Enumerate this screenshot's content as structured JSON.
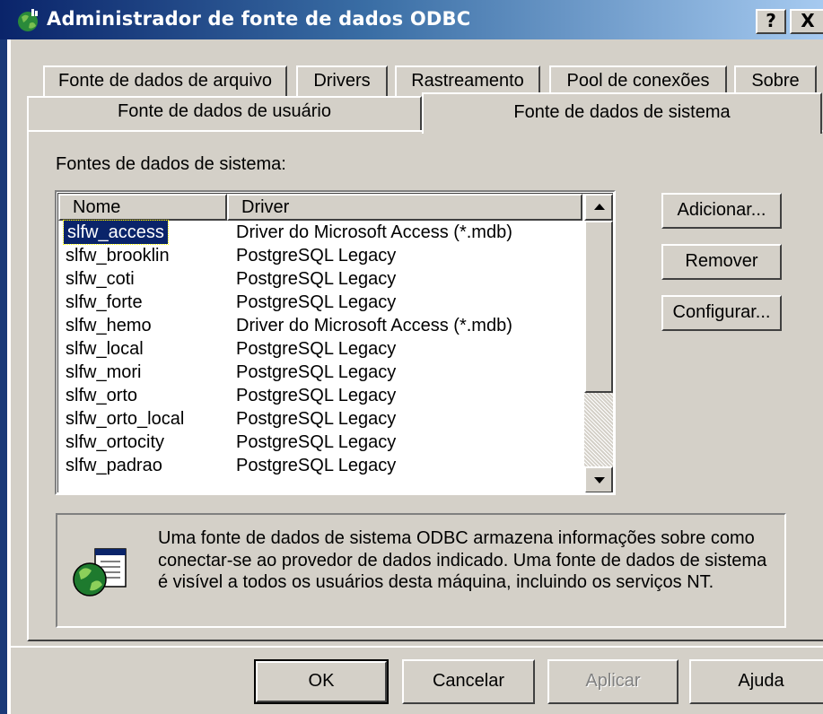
{
  "window": {
    "title": "Administrador de fonte de dados ODBC",
    "help_btn": "?",
    "close_btn": "X"
  },
  "tabs": {
    "row1": [
      "Fonte de dados de arquivo",
      "Drivers",
      "Rastreamento",
      "Pool de conexões",
      "Sobre"
    ],
    "row2": [
      "Fonte de dados de usuário",
      "Fonte de dados de sistema"
    ],
    "active": "Fonte de dados de sistema"
  },
  "list": {
    "label": "Fontes de dados de sistema:",
    "columns": [
      "Nome",
      "Driver"
    ],
    "rows": [
      {
        "name": "slfw_access",
        "driver": "Driver do Microsoft Access (*.mdb)"
      },
      {
        "name": "slfw_brooklin",
        "driver": "PostgreSQL Legacy"
      },
      {
        "name": "slfw_coti",
        "driver": "PostgreSQL Legacy"
      },
      {
        "name": "slfw_forte",
        "driver": "PostgreSQL Legacy"
      },
      {
        "name": "slfw_hemo",
        "driver": "Driver do Microsoft Access (*.mdb)"
      },
      {
        "name": "slfw_local",
        "driver": "PostgreSQL Legacy"
      },
      {
        "name": "slfw_mori",
        "driver": "PostgreSQL Legacy"
      },
      {
        "name": "slfw_orto",
        "driver": "PostgreSQL Legacy"
      },
      {
        "name": "slfw_orto_local",
        "driver": "PostgreSQL Legacy"
      },
      {
        "name": "slfw_ortocity",
        "driver": "PostgreSQL Legacy"
      },
      {
        "name": "slfw_padrao",
        "driver": "PostgreSQL Legacy"
      }
    ],
    "selected_index": 0
  },
  "side_buttons": {
    "add": "Adicionar...",
    "remove": "Remover",
    "configure": "Configurar..."
  },
  "info": {
    "text": "Uma fonte de dados de sistema ODBC armazena informações sobre como conectar-se ao provedor de dados indicado. Uma fonte de dados de sistema é visível a todos os usuários desta máquina, incluindo os serviços NT."
  },
  "dialog_buttons": {
    "ok": "OK",
    "cancel": "Cancelar",
    "apply": "Aplicar",
    "help": "Ajuda"
  },
  "colors": {
    "titlebar_start": "#0a246a",
    "titlebar_end": "#a6caf0",
    "face": "#d4d0c8",
    "selection": "#0a246a"
  }
}
